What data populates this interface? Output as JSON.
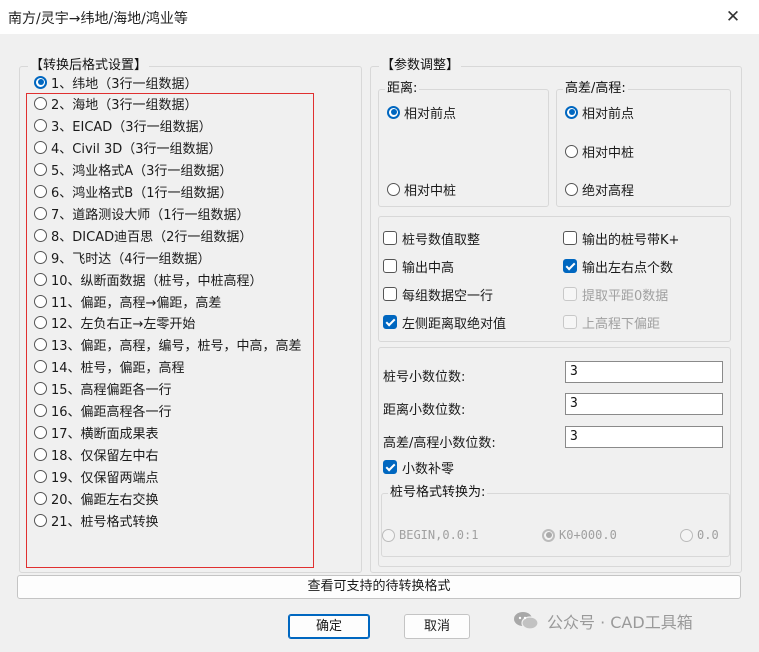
{
  "window": {
    "title": "南方/灵宇→纬地/海地/鸿业等",
    "close_glyph": "✕"
  },
  "format_group": {
    "title": "【转换后格式设置】",
    "options": [
      {
        "label": "1、纬地（3行一组数据）",
        "checked": true
      },
      {
        "label": "2、海地（3行一组数据）",
        "checked": false
      },
      {
        "label": "3、EICAD（3行一组数据）",
        "checked": false
      },
      {
        "label": "4、Civil 3D（3行一组数据）",
        "checked": false
      },
      {
        "label": "5、鸿业格式A（3行一组数据）",
        "checked": false
      },
      {
        "label": "6、鸿业格式B（1行一组数据）",
        "checked": false
      },
      {
        "label": "7、道路测设大师（1行一组数据）",
        "checked": false
      },
      {
        "label": "8、DICAD迪百思（2行一组数据）",
        "checked": false
      },
      {
        "label": "9、飞时达（4行一组数据）",
        "checked": false
      },
      {
        "label": "10、纵断面数据（桩号，中桩高程）",
        "checked": false
      },
      {
        "label": "11、偏距，高程→偏距，高差",
        "checked": false
      },
      {
        "label": "12、左负右正→左零开始",
        "checked": false
      },
      {
        "label": "13、偏距，高程，编号，桩号，中高，高差",
        "checked": false
      },
      {
        "label": "14、桩号，偏距，高程",
        "checked": false
      },
      {
        "label": "15、高程偏距各一行",
        "checked": false
      },
      {
        "label": "16、偏距高程各一行",
        "checked": false
      },
      {
        "label": "17、横断面成果表",
        "checked": false
      },
      {
        "label": "18、仅保留左中右",
        "checked": false
      },
      {
        "label": "19、仅保留两端点",
        "checked": false
      },
      {
        "label": "20、偏距左右交换",
        "checked": false
      },
      {
        "label": "21、桩号格式转换",
        "checked": false
      }
    ]
  },
  "params": {
    "title": "【参数调整】",
    "distance": {
      "title": "距离:",
      "options": [
        {
          "label": "相对前点",
          "checked": true
        },
        {
          "label": "相对中桩",
          "checked": false
        }
      ]
    },
    "elevation": {
      "title": "高差/高程:",
      "options": [
        {
          "label": "相对前点",
          "checked": true
        },
        {
          "label": "相对中桩",
          "checked": false
        },
        {
          "label": "绝对高程",
          "checked": false
        }
      ]
    },
    "checkboxes": [
      {
        "label": "桩号数值取整",
        "checked": false,
        "enabled": true
      },
      {
        "label": "输出的桩号带K+",
        "checked": false,
        "enabled": true
      },
      {
        "label": "输出中高",
        "checked": false,
        "enabled": true
      },
      {
        "label": "输出左右点个数",
        "checked": true,
        "enabled": true
      },
      {
        "label": "每组数据空一行",
        "checked": false,
        "enabled": true
      },
      {
        "label": "提取平距0数据",
        "checked": false,
        "enabled": false
      },
      {
        "label": "左侧距离取绝对值",
        "checked": true,
        "enabled": true
      },
      {
        "label": "上高程下偏距",
        "checked": false,
        "enabled": false
      }
    ],
    "decimals": {
      "station_label": "桩号小数位数:",
      "station_value": "3",
      "distance_label": "距离小数位数:",
      "distance_value": "3",
      "elev_label": "高差/高程小数位数:",
      "elev_value": "3",
      "pad_zero_label": "小数补零",
      "pad_zero_checked": true
    },
    "station_format": {
      "title": "桩号格式转换为:",
      "options": [
        {
          "label": "BEGIN,0.0:1",
          "checked": false
        },
        {
          "label": "K0+000.0",
          "checked": true
        },
        {
          "label": "0.0",
          "checked": false
        }
      ]
    }
  },
  "buttons": {
    "view_formats": "查看可支持的待转换格式",
    "ok": "确定",
    "cancel": "取消"
  },
  "watermark": {
    "text": "公众号 · CAD工具箱",
    "icon": "wechat-icon"
  },
  "colors": {
    "accent": "#0067c0",
    "highlight_border": "#e03030"
  }
}
